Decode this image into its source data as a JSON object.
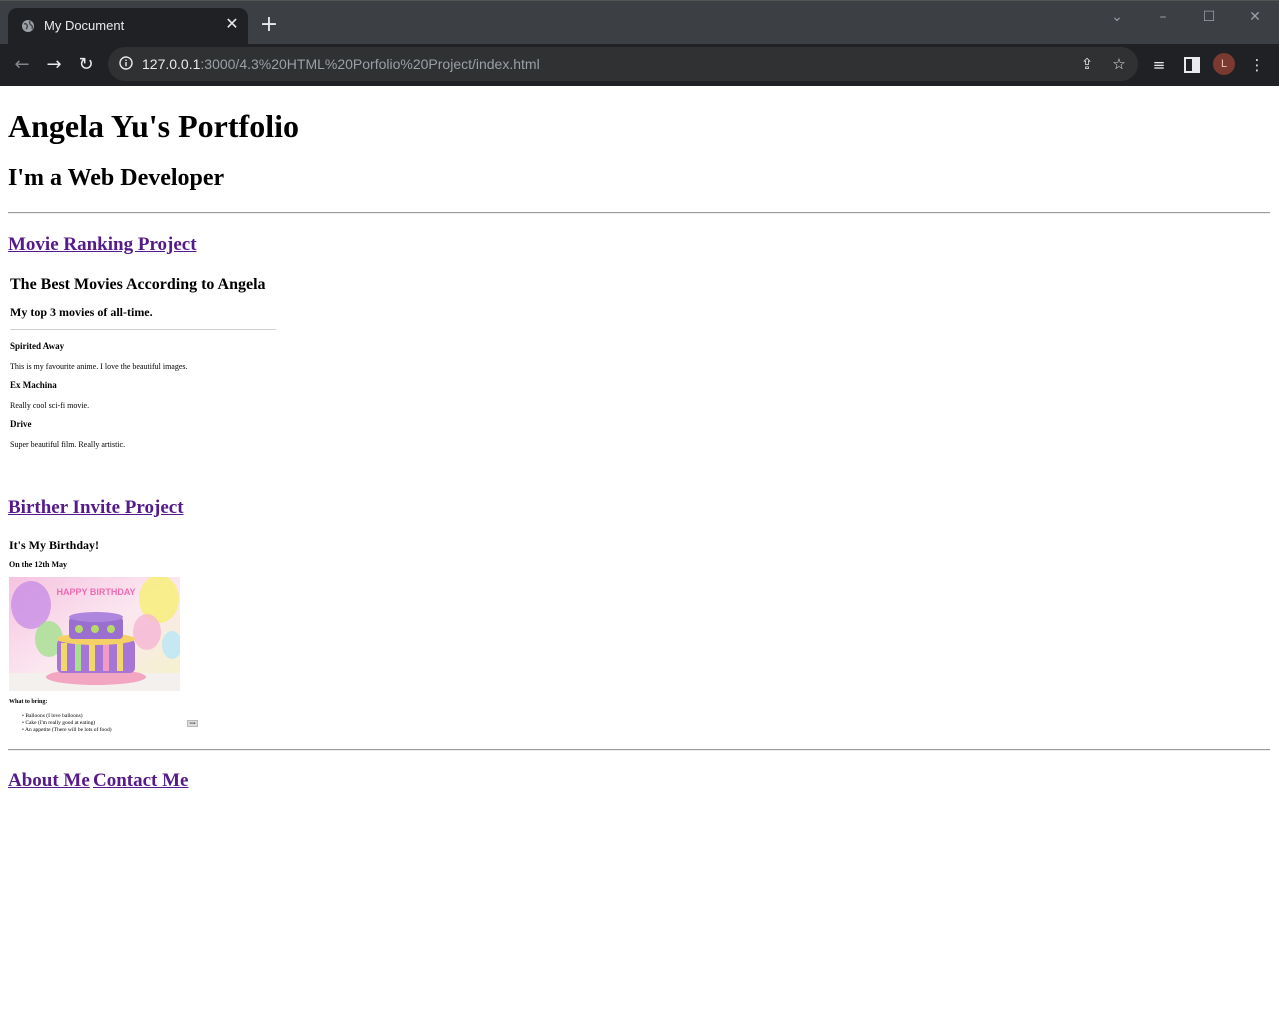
{
  "browser": {
    "tab_title": "My Document",
    "url_host": "127.0.0.1",
    "url_path": ":3000/4.3%20HTML%20Porfolio%20Project/index.html",
    "profile_initial": "L",
    "icons": [
      "globe-icon",
      "close-icon",
      "plus-icon",
      "chevron-down-icon",
      "minimize-icon",
      "maximize-icon",
      "window-close-icon",
      "back-arrow-icon",
      "forward-arrow-icon",
      "reload-icon",
      "info-icon",
      "share-icon",
      "star-icon",
      "media-queue-icon",
      "side-panel-icon",
      "kebab-menu-icon"
    ]
  },
  "page": {
    "title": "Angela Yu's Portfolio",
    "subtitle": "I'm a Web Developer",
    "movie_project": {
      "link": "Movie Ranking Project",
      "frame_title": "The Best Movies According to Angela",
      "frame_subtitle": "My top 3 movies of all-time.",
      "movies": [
        {
          "name": "Spirited Away",
          "desc": "This is my favourite anime. I love the beautiful images."
        },
        {
          "name": "Ex Machina",
          "desc": "Really cool sci-fi movie."
        },
        {
          "name": "Drive",
          "desc": "Super beautiful film. Really artistic."
        }
      ]
    },
    "birthday_project": {
      "link": "Birther Invite Project",
      "heading": "It's My Birthday!",
      "date": "On the 12th May",
      "cake_caption": "HAPPY BIRTHDAY",
      "bring_heading": "What to bring:",
      "items": [
        "Balloons (I love balloons)",
        "Cake (I'm really good at eating)",
        "An appetite (There will be lots of food)"
      ],
      "button_label": "Link"
    },
    "footer": {
      "about": "About Me",
      "contact": "Contact Me"
    }
  }
}
